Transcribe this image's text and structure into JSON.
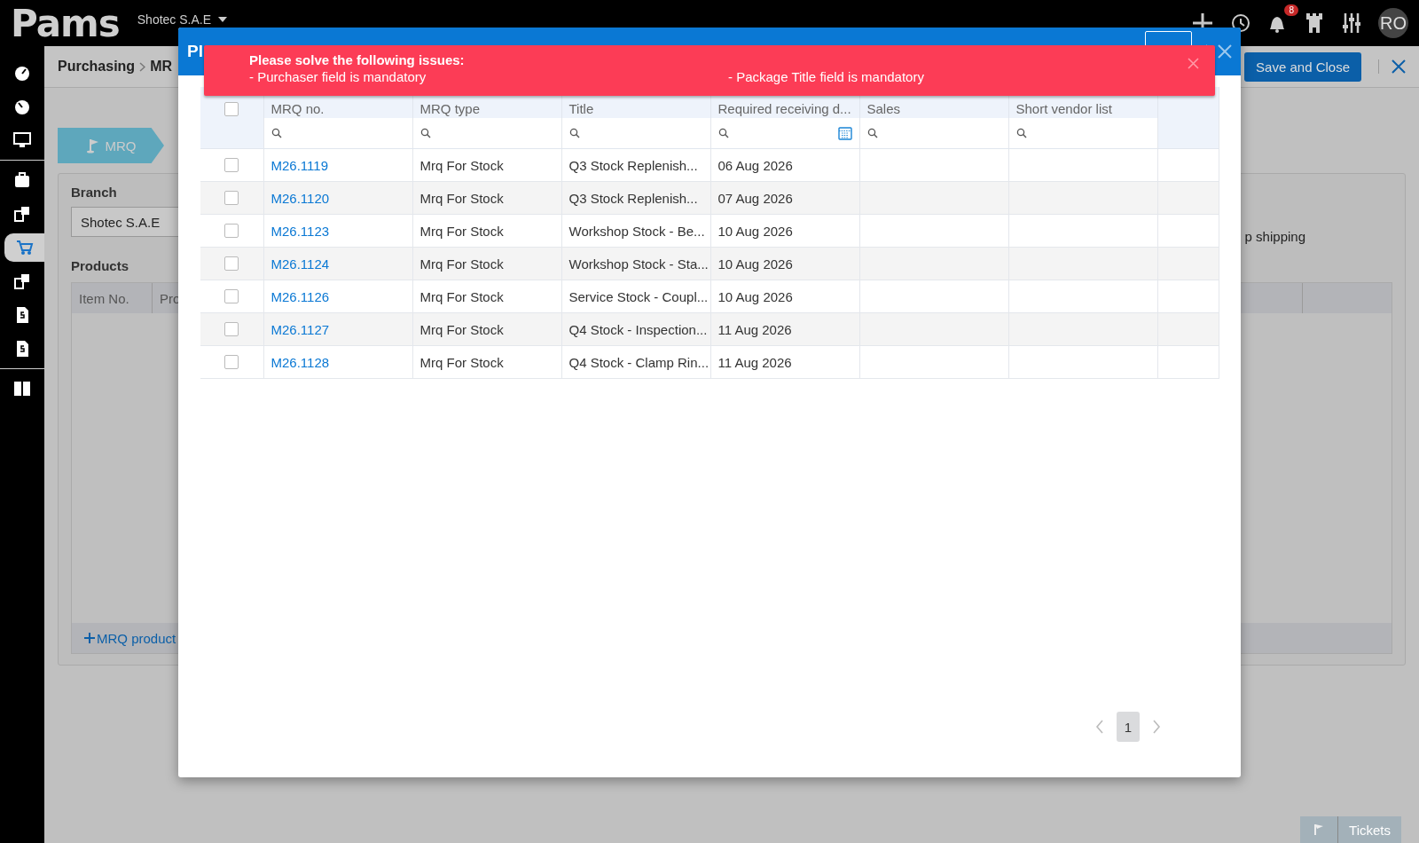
{
  "topbar": {
    "logo": "Pams",
    "company": "Shotec S.A.E",
    "notifications": "8",
    "avatar": "RO"
  },
  "sidebar": {
    "groups": [
      [
        {
          "selected": false
        },
        {
          "selected": false
        },
        {
          "selected": false
        }
      ],
      [
        {
          "selected": false
        },
        {
          "selected": false
        },
        {
          "selected": true
        },
        {
          "selected": false
        },
        {
          "selected": false
        },
        {
          "selected": false
        }
      ],
      [
        {
          "selected": false
        }
      ]
    ]
  },
  "page": {
    "breadcrumb": [
      "Purchasing",
      "MR"
    ],
    "save_button": "Save and Close",
    "step": "MRQ",
    "branch_label": "Branch",
    "branch_value": "Shotec S.A.E",
    "products_label": "Products",
    "products_columns": [
      "Item No.",
      "Pro"
    ],
    "add_product": "MRQ product",
    "right_label": "p shipping",
    "tickets": "Tickets"
  },
  "modal": {
    "title": "Pl",
    "select_all_checked": false,
    "columns": [
      "MRQ no.",
      "MRQ type",
      "Title",
      "Required receiving d...",
      "Sales",
      "Short vendor list"
    ],
    "rows": [
      {
        "checked": false,
        "mrq_no": "M26.1119",
        "type": "Mrq For Stock",
        "title": "Q3 Stock Replenish...",
        "date": "06 Aug 2026"
      },
      {
        "checked": false,
        "mrq_no": "M26.1120",
        "type": "Mrq For Stock",
        "title": "Q3 Stock Replenish...",
        "date": "07 Aug 2026"
      },
      {
        "checked": false,
        "mrq_no": "M26.1123",
        "type": "Mrq For Stock",
        "title": "Workshop Stock - Be...",
        "date": "10 Aug 2026"
      },
      {
        "checked": false,
        "mrq_no": "M26.1124",
        "type": "Mrq For Stock",
        "title": "Workshop Stock - Sta...",
        "date": "10 Aug 2026"
      },
      {
        "checked": false,
        "mrq_no": "M26.1126",
        "type": "Mrq For Stock",
        "title": "Service Stock - Coupl...",
        "date": "10 Aug 2026"
      },
      {
        "checked": false,
        "mrq_no": "M26.1127",
        "type": "Mrq For Stock",
        "title": "Q4 Stock - Inspection...",
        "date": "11 Aug 2026"
      },
      {
        "checked": false,
        "mrq_no": "M26.1128",
        "type": "Mrq For Stock",
        "title": "Q4 Stock - Clamp Rin...",
        "date": "11 Aug 2026"
      }
    ],
    "pages": [
      {
        "label": "1",
        "selected": true
      }
    ]
  },
  "toast": {
    "title": "Please solve the following issues:",
    "messages": [
      "- Purchaser field is mandatory",
      "- Package Title field is mandatory"
    ]
  }
}
